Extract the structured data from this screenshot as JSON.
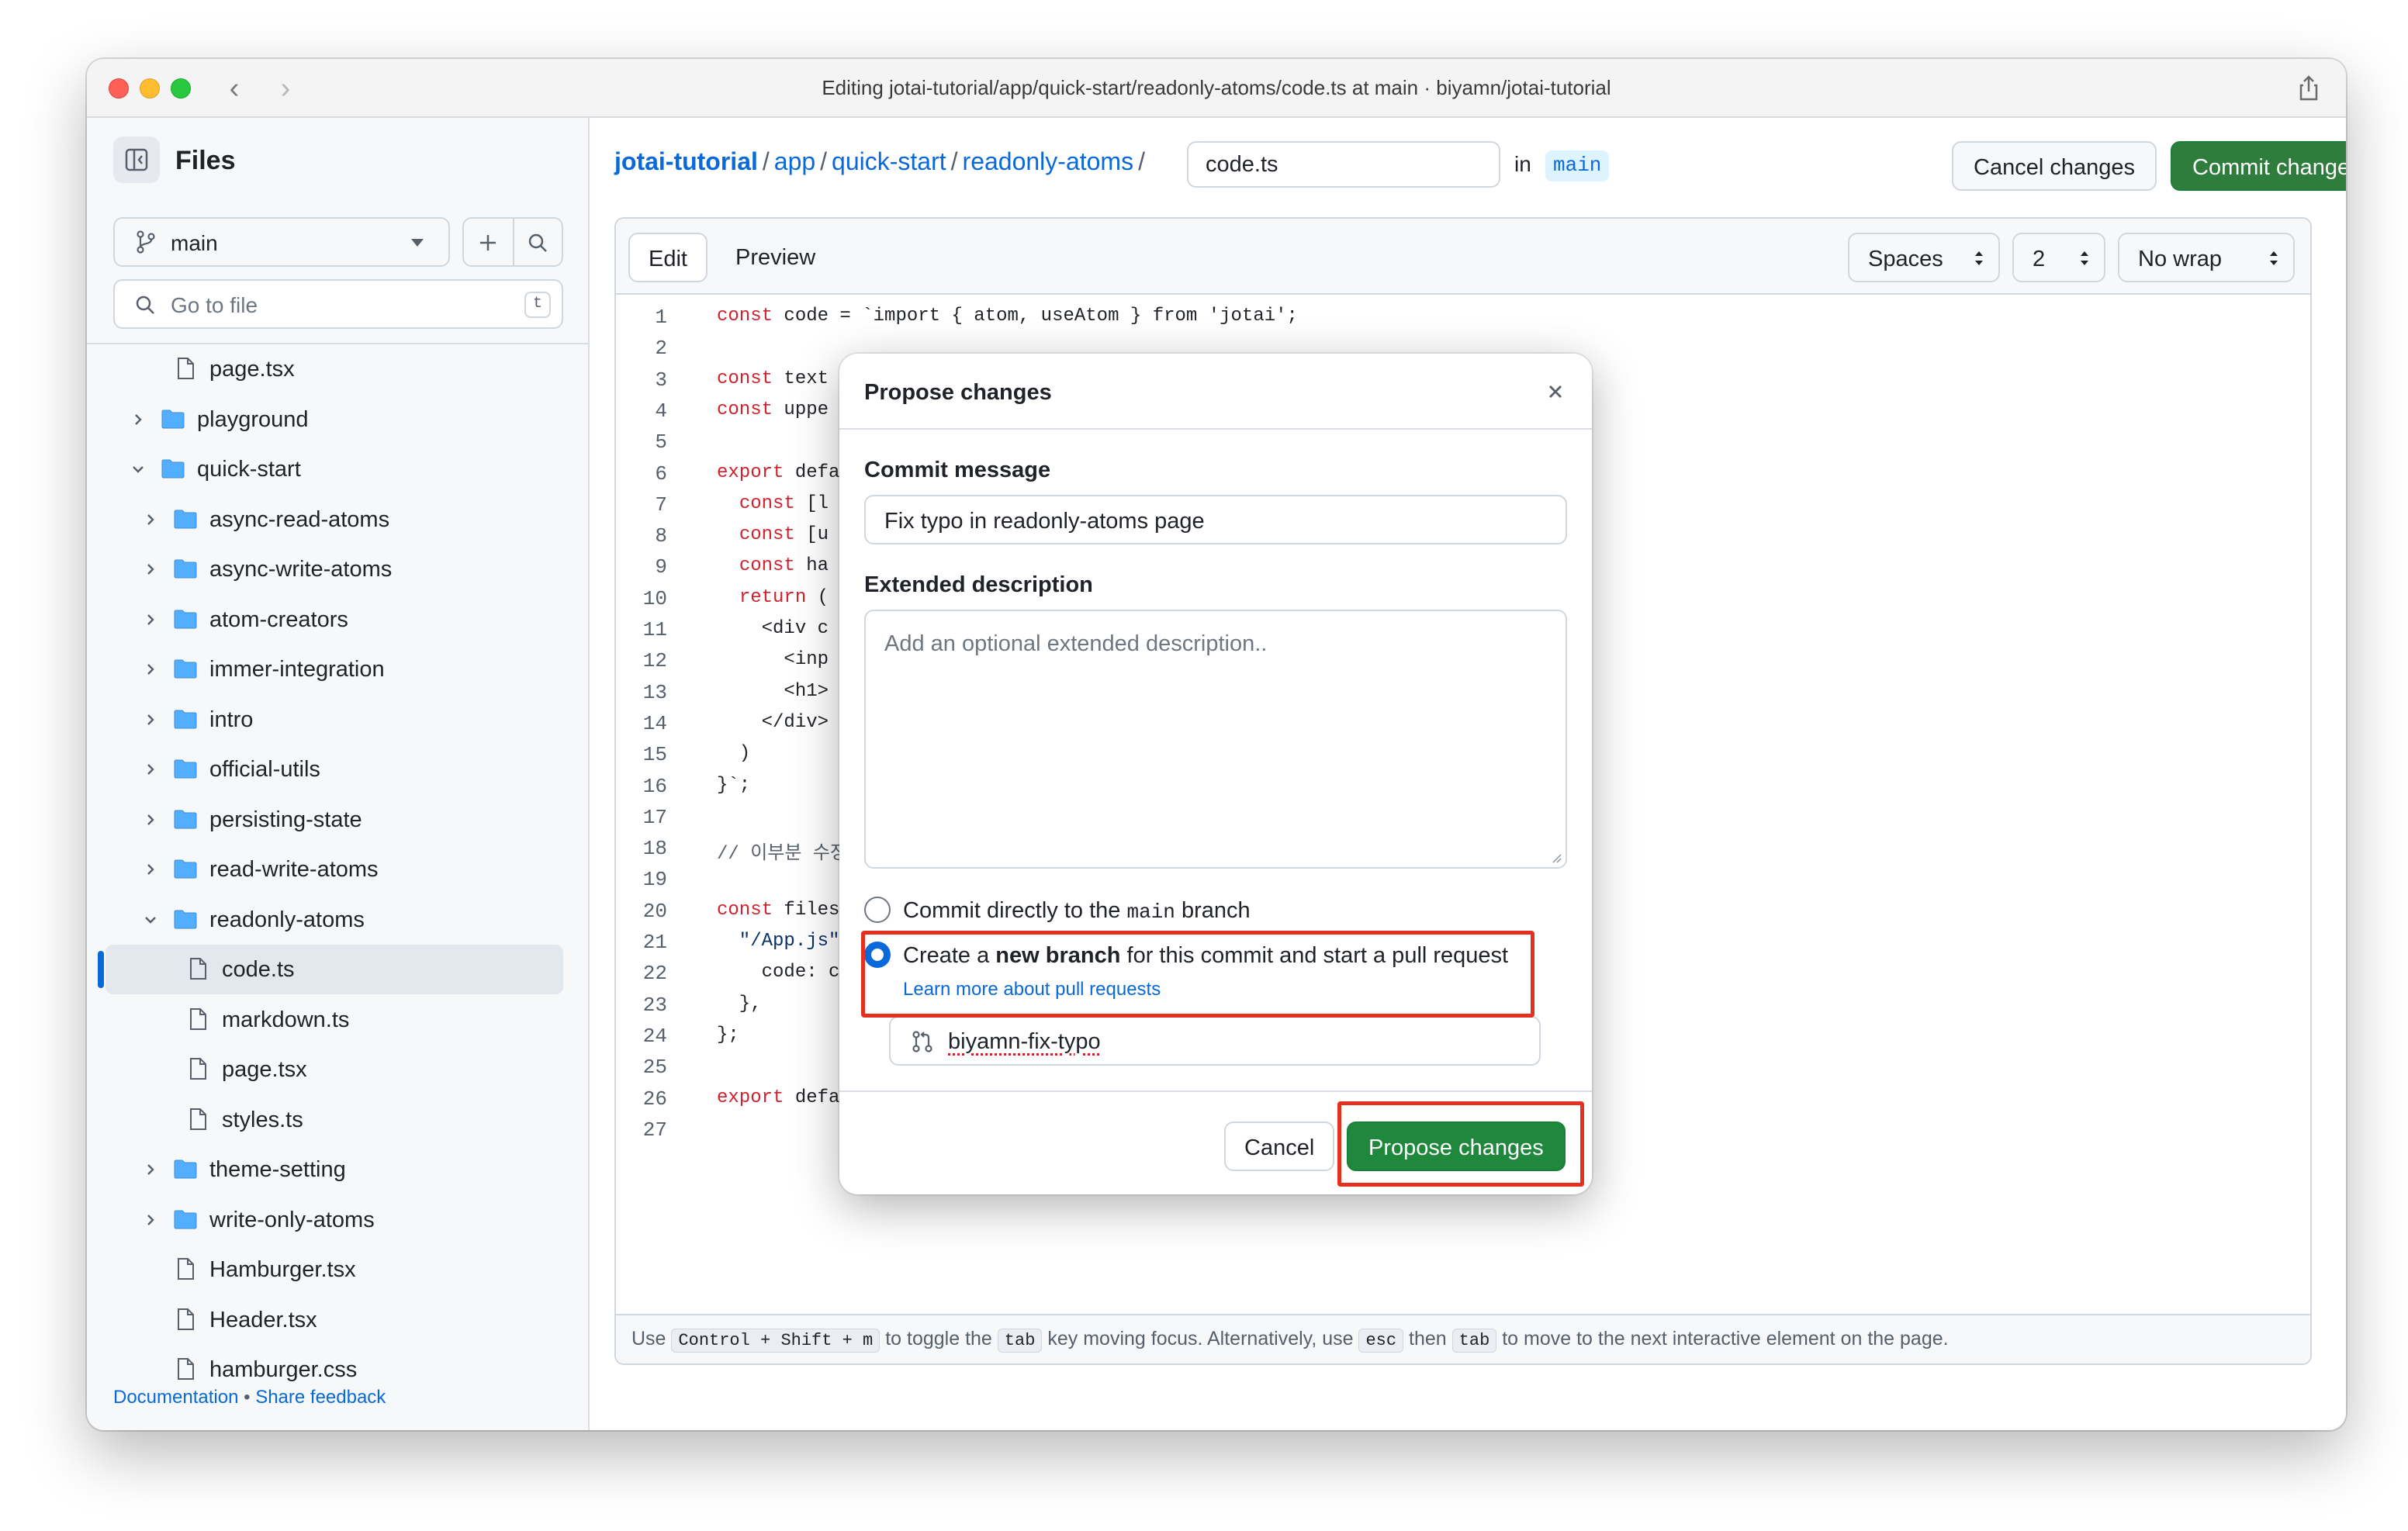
{
  "window": {
    "title": "Editing jotai-tutorial/app/quick-start/readonly-atoms/code.ts at main · biyamn/jotai-tutorial"
  },
  "sidebar": {
    "title": "Files",
    "branch": "main",
    "go_to_file_placeholder": "Go to file",
    "go_to_file_shortcut": "t",
    "tree": [
      {
        "name": "page.tsx",
        "type": "file",
        "depth": 1
      },
      {
        "name": "playground",
        "type": "folder",
        "depth": 0,
        "expanded": false
      },
      {
        "name": "quick-start",
        "type": "folder",
        "depth": 0,
        "expanded": true
      },
      {
        "name": "async-read-atoms",
        "type": "folder",
        "depth": 1,
        "expanded": false
      },
      {
        "name": "async-write-atoms",
        "type": "folder",
        "depth": 1,
        "expanded": false
      },
      {
        "name": "atom-creators",
        "type": "folder",
        "depth": 1,
        "expanded": false
      },
      {
        "name": "immer-integration",
        "type": "folder",
        "depth": 1,
        "expanded": false
      },
      {
        "name": "intro",
        "type": "folder",
        "depth": 1,
        "expanded": false
      },
      {
        "name": "official-utils",
        "type": "folder",
        "depth": 1,
        "expanded": false
      },
      {
        "name": "persisting-state",
        "type": "folder",
        "depth": 1,
        "expanded": false
      },
      {
        "name": "read-write-atoms",
        "type": "folder",
        "depth": 1,
        "expanded": false
      },
      {
        "name": "readonly-atoms",
        "type": "folder",
        "depth": 1,
        "expanded": true
      },
      {
        "name": "code.ts",
        "type": "file",
        "depth": 2,
        "selected": true
      },
      {
        "name": "markdown.ts",
        "type": "file",
        "depth": 2
      },
      {
        "name": "page.tsx",
        "type": "file",
        "depth": 2
      },
      {
        "name": "styles.ts",
        "type": "file",
        "depth": 2
      },
      {
        "name": "theme-setting",
        "type": "folder",
        "depth": 1,
        "expanded": false
      },
      {
        "name": "write-only-atoms",
        "type": "folder",
        "depth": 1,
        "expanded": false
      },
      {
        "name": "Hamburger.tsx",
        "type": "file",
        "depth": 1
      },
      {
        "name": "Header.tsx",
        "type": "file",
        "depth": 1
      },
      {
        "name": "hamburger.css",
        "type": "file",
        "depth": 1
      }
    ],
    "footer": {
      "documentation": "Documentation",
      "separator": "•",
      "feedback": "Share feedback"
    }
  },
  "header": {
    "breadcrumb": [
      "jotai-tutorial",
      "app",
      "quick-start",
      "readonly-atoms"
    ],
    "separator": "/",
    "filename": "code.ts",
    "in_label": "in",
    "branch": "main",
    "cancel_label": "Cancel changes",
    "commit_label": "Commit changes..."
  },
  "editor": {
    "tab_edit": "Edit",
    "tab_preview": "Preview",
    "indent_mode": "Spaces",
    "indent_size": "2",
    "wrap_mode": "No wrap",
    "lines": [
      {
        "n": "1",
        "text": "const code = `import { atom, useAtom } from 'jotai';"
      },
      {
        "n": "2",
        "text": ""
      },
      {
        "n": "3",
        "text": "const text"
      },
      {
        "n": "4",
        "text": "const uppe"
      },
      {
        "n": "5",
        "text": ""
      },
      {
        "n": "6",
        "text": "export defa"
      },
      {
        "n": "7",
        "text": "  const [l"
      },
      {
        "n": "8",
        "text": "  const [u"
      },
      {
        "n": "9",
        "text": "  const ha"
      },
      {
        "n": "10",
        "text": "  return ("
      },
      {
        "n": "11",
        "text": "    <div c"
      },
      {
        "n": "12",
        "text": "      <inp"
      },
      {
        "n": "13",
        "text": "      <h1>"
      },
      {
        "n": "14",
        "text": "    </div>"
      },
      {
        "n": "15",
        "text": "  )"
      },
      {
        "n": "16",
        "text": "}`;"
      },
      {
        "n": "17",
        "text": ""
      },
      {
        "n": "18",
        "text": "// 이부분 수정"
      },
      {
        "n": "19",
        "text": ""
      },
      {
        "n": "20",
        "text": "const files"
      },
      {
        "n": "21",
        "text": "  \"/App.js\""
      },
      {
        "n": "22",
        "text": "    code: c"
      },
      {
        "n": "23",
        "text": "  },"
      },
      {
        "n": "24",
        "text": "};"
      },
      {
        "n": "25",
        "text": ""
      },
      {
        "n": "26",
        "text": "export defa"
      },
      {
        "n": "27",
        "text": ""
      }
    ],
    "hint": {
      "p1": "Use",
      "k1": "Control + Shift + m",
      "p2": "to toggle the",
      "k2": "tab",
      "p3": "key moving focus. Alternatively, use",
      "k3": "esc",
      "p4": "then",
      "k4": "tab",
      "p5": "to move to the next interactive element on the page."
    }
  },
  "modal": {
    "title": "Propose changes",
    "commit_message_label": "Commit message",
    "commit_message_value": "Fix typo in readonly-atoms page",
    "extended_label": "Extended description",
    "extended_placeholder": "Add an optional extended description..",
    "option_direct_prefix": "Commit directly to the",
    "option_direct_branch": "main",
    "option_direct_suffix": "branch",
    "option_new_prefix": "Create a",
    "option_new_bold": "new branch",
    "option_new_suffix": "for this commit and start a pull request",
    "learn_more": "Learn more about pull requests",
    "new_branch_name": "biyamn-fix-typo",
    "cancel_label": "Cancel",
    "propose_label": "Propose changes"
  },
  "colors": {
    "primary_green": "#1f883d",
    "link_blue": "#0969da",
    "annotation_red": "#e5301f"
  }
}
